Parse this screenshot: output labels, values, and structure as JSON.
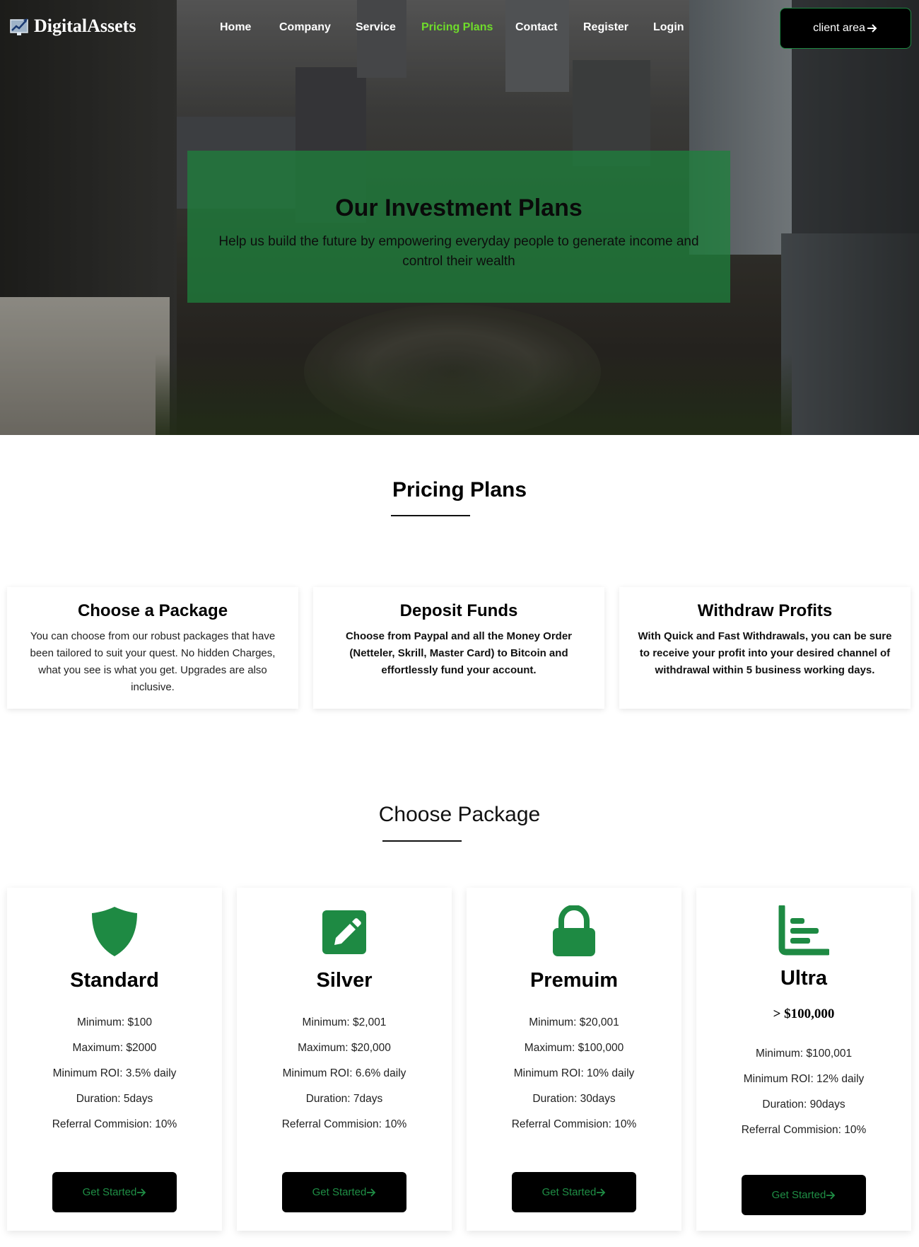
{
  "brand": {
    "name": "DigitalAssets",
    "accent": "#1e8a43",
    "nav_active": "#6fdc2b"
  },
  "nav": {
    "items": [
      {
        "label": "Home",
        "active": false
      },
      {
        "label": "Company",
        "active": false
      },
      {
        "label": "Service",
        "active": false
      },
      {
        "label": "Pricing Plans",
        "active": true
      },
      {
        "label": "Contact",
        "active": false
      },
      {
        "label": "Register",
        "active": false
      },
      {
        "label": "Login",
        "active": false
      }
    ],
    "client_button": "client area"
  },
  "hero": {
    "title": "Our Investment Plans",
    "subtitle": "Help us build the future by empowering everyday people to generate income and control their wealth"
  },
  "pricing": {
    "title": "Pricing Plans",
    "steps": [
      {
        "title": "Choose a Package",
        "text": "You can choose from our robust packages that have been tailored to suit your quest. No hidden Charges, what you see is what you get. Upgrades are also inclusive."
      },
      {
        "title": "Deposit Funds",
        "text": "Choose from Paypal and all the Money Order (Netteler, Skrill, Master Card) to Bitcoin and effortlessly fund your account."
      },
      {
        "title": "Withdraw Profits",
        "text": "With Quick and Fast Withdrawals, you can be sure to receive your profit into your desired channel of withdrawal within 5 business working days."
      }
    ]
  },
  "packages": {
    "title": "Choose Package",
    "plans": [
      {
        "name": "Standard",
        "icon": "shield-icon",
        "details": [
          "Minimum: $100",
          "Maximum: $2000",
          "Minimum ROI: 3.5% daily",
          "Duration: 5days",
          "Referral Commision: 10%"
        ],
        "cta": "Get Started"
      },
      {
        "name": "Silver",
        "icon": "edit-icon",
        "details": [
          "Minimum: $2,001",
          "Maximum: $20,000",
          "Minimum ROI: 6.6% daily",
          "Duration: 7days",
          "Referral Commision: 10%"
        ],
        "cta": "Get Started"
      },
      {
        "name": "Premuim",
        "icon": "lock-icon",
        "details": [
          "Minimum: $20,001",
          "Maximum: $100,000",
          "Minimum ROI: 10% daily",
          "Duration: 30days",
          "Referral Commision: 10%"
        ],
        "cta": "Get Started"
      },
      {
        "name": "Ultra",
        "icon": "bar-chart-icon",
        "price": "> $100,000",
        "details": [
          "Minimum: $100,001",
          "Minimum ROI: 12% daily",
          "Duration: 90days",
          "Referral Commision: 10%"
        ],
        "cta": "Get Started"
      }
    ]
  }
}
